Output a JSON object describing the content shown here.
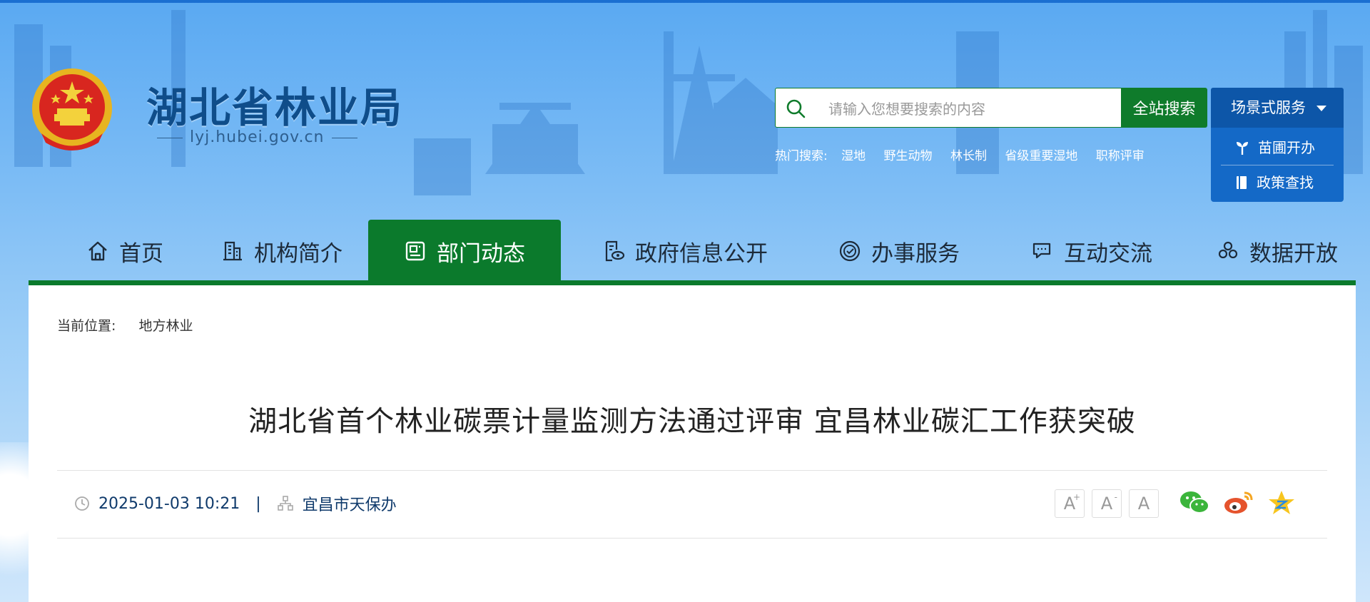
{
  "header": {
    "site_title": "湖北省林业局",
    "site_domain": "lyj.hubei.gov.cn"
  },
  "search": {
    "placeholder": "请输入您想要搜索的内容",
    "button_label": "全站搜索",
    "hot_label": "热门搜索:",
    "hot_keywords": [
      "湿地",
      "野生动物",
      "林长制",
      "省级重要湿地",
      "职称评审"
    ]
  },
  "scene_service": {
    "title": "场景式服务",
    "items": [
      "苗圃开办",
      "政策查找"
    ]
  },
  "nav": {
    "items": [
      {
        "label": "首页",
        "icon": "home-icon"
      },
      {
        "label": "机构简介",
        "icon": "building-icon"
      },
      {
        "label": "部门动态",
        "icon": "news-icon",
        "active": true
      },
      {
        "label": "政府信息公开",
        "icon": "document-eye-icon"
      },
      {
        "label": "办事服务",
        "icon": "service-icon"
      },
      {
        "label": "互动交流",
        "icon": "chat-icon"
      },
      {
        "label": "数据开放",
        "icon": "data-icon"
      }
    ]
  },
  "breadcrumb": {
    "label": "当前位置:",
    "current": "地方林业"
  },
  "article": {
    "title": "湖北省首个林业碳票计量监测方法通过评审 宜昌林业碳汇工作获突破",
    "datetime": "2025-01-03 10:21",
    "source": "宜昌市天保办",
    "separator": "|"
  },
  "font_controls": [
    "A",
    "A",
    "A"
  ],
  "colors": {
    "primary_green": "#0b7a2c",
    "primary_blue": "#0d56a8",
    "title_blue": "#0f4d8a"
  }
}
